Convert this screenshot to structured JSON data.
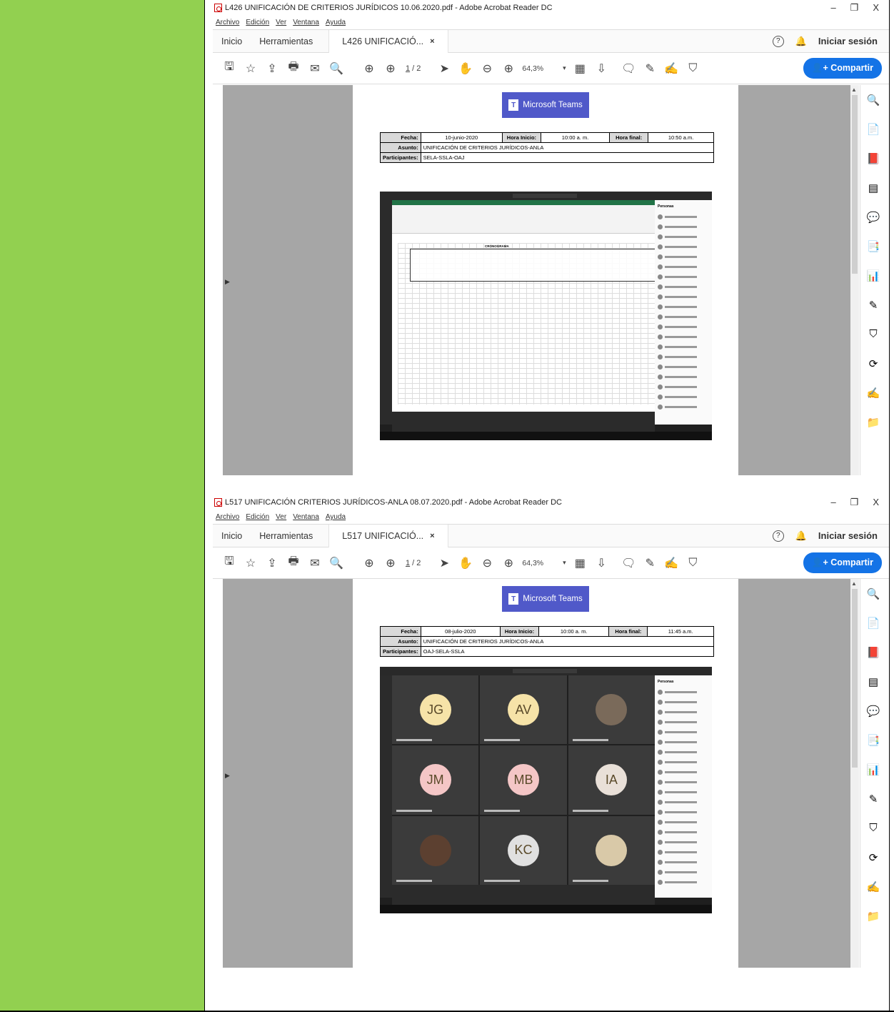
{
  "windows": [
    {
      "title": "L426 UNIFICACIÓN DE CRITERIOS JURÍDICOS 10.06.2020.pdf - Adobe Acrobat Reader DC",
      "tab_label": "L426 UNIFICACIÓ...",
      "meeting": {
        "fecha_label": "Fecha:",
        "fecha": "10-junio-2020",
        "hora_inicio_label": "Hora Inicio:",
        "hora_inicio": "10:00 a. m.",
        "hora_final_label": "Hora final:",
        "hora_final": "10:50 a.m.",
        "asunto_label": "Asunto:",
        "asunto": "UNIFICACIÓN DE CRITERIOS JURÍDICOS-ANLA",
        "participantes_label": "Participantes:",
        "participantes": "SELA-SSLA-OAJ"
      },
      "screenshot_caption": "CRONOGRAMA"
    },
    {
      "title": "L517 UNIFICACIÓN CRITERIOS JURÍDICOS-ANLA 08.07.2020.pdf - Adobe Acrobat Reader DC",
      "tab_label": "L517 UNIFICACIÓ...",
      "meeting": {
        "fecha_label": "Fecha:",
        "fecha": "08-julio-2020",
        "hora_inicio_label": "Hora Inicio:",
        "hora_inicio": "10:00 a. m.",
        "hora_final_label": "Hora final:",
        "hora_final": "11:45 a.m.",
        "asunto_label": "Asunto:",
        "asunto": "UNIFICACIÓN DE CRITERIOS JURÍDICOS-ANLA",
        "participantes_label": "Participantes:",
        "participantes": "OAJ-SELA-SSLA"
      },
      "participants": [
        {
          "initials": "JG",
          "color": "#f6e3a8"
        },
        {
          "initials": "AV",
          "color": "#f6e3a8"
        },
        {
          "initials": "",
          "color": "#7a6a5a"
        },
        {
          "initials": "JM",
          "color": "#f4c6c6"
        },
        {
          "initials": "MB",
          "color": "#f4c6c6"
        },
        {
          "initials": "IA",
          "color": "#e9e0d8"
        },
        {
          "initials": "",
          "color": "#5c4030"
        },
        {
          "initials": "KC",
          "color": "#e0e0e0"
        },
        {
          "initials": "",
          "color": "#d9c9a8"
        }
      ]
    }
  ],
  "menu": [
    "Archivo",
    "Edición",
    "Ver",
    "Ventana",
    "Ayuda"
  ],
  "tabs": {
    "inicio": "Inicio",
    "herramientas": "Herramientas",
    "close": "×"
  },
  "signin": "Iniciar sesión",
  "share": "Compartir",
  "page": {
    "current": "1",
    "total": "/ 2"
  },
  "zoom": "64,3%",
  "teams_logo": "Microsoft Teams",
  "people_header": "Personas",
  "window_controls": {
    "minimize": "–",
    "restore": "❐",
    "close": "X"
  }
}
